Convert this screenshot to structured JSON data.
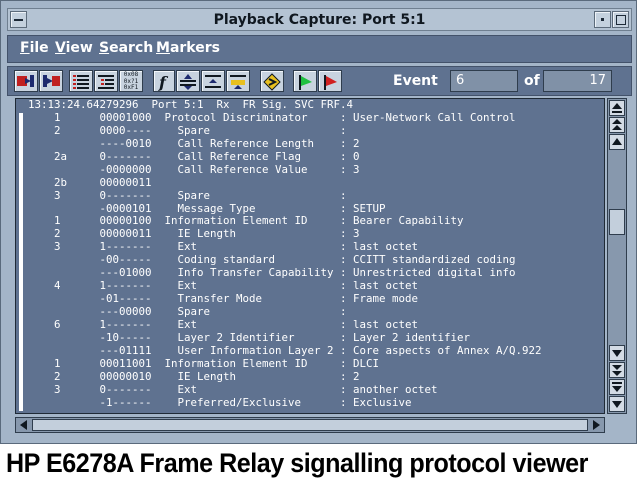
{
  "window": {
    "title": "Playback Capture: Port 5:1"
  },
  "menu": {
    "items": [
      "File",
      "View",
      "Search",
      "Markers"
    ]
  },
  "toolbar": {
    "buttons": [
      {
        "name": "import-icon"
      },
      {
        "name": "export-icon"
      },
      {
        "name": "summary-list-icon"
      },
      {
        "name": "detail-list-icon"
      },
      {
        "name": "hex-view-icon",
        "text": "0x08\n0x?1\n0xF1"
      },
      {
        "name": "filter-icon"
      },
      {
        "name": "expand-icon"
      },
      {
        "name": "collapse-icon"
      },
      {
        "name": "trigger-icon"
      },
      {
        "name": "scroll-icon"
      },
      {
        "name": "green-flag-icon"
      },
      {
        "name": "red-flag-icon"
      }
    ],
    "event_label": "Event",
    "event_value": "6",
    "of_label": "of",
    "total_value": "17"
  },
  "decode_lines": [
    "13:13:24.64279296  Port 5:1  Rx  FR Sig. SVC FRF.4",
    "    1      00001000  Protocol Discriminator     : User-Network Call Control",
    "    2      0000----    Spare                    :",
    "           ----0010    Call Reference Length    : 2",
    "    2a     0-------    Call Reference Flag      : 0",
    "           -0000000    Call Reference Value     : 3",
    "    2b     00000011",
    "    3      0-------    Spare                    :",
    "           -0000101    Message Type             : SETUP",
    "    1      00000100  Information Element ID     : Bearer Capability",
    "    2      00000011    IE Length                : 3",
    "    3      1-------    Ext                      : last octet",
    "           -00-----    Coding standard          : CCITT standardized coding",
    "           ---01000    Info Transfer Capability : Unrestricted digital info",
    "    4      1-------    Ext                      : last octet",
    "           -01-----    Transfer Mode            : Frame mode",
    "           ---00000    Spare                    :",
    "    6      1-------    Ext                      : last octet",
    "           -10-----    Layer 2 Identifier       : Layer 2 identifier",
    "           ---01111    User Information Layer 2 : Core aspects of Annex A/Q.922",
    "    1      00011001  Information Element ID     : DLCI",
    "    2      00000010    IE Length                : 2",
    "    3      0-------    Ext                      : another octet",
    "           -1------    Preferred/Exclusive      : Exclusive"
  ],
  "caption": "HP E6278A Frame Relay signalling protocol viewer",
  "colors": {
    "window_bg": "#a4b5c8",
    "panel_bg": "#5f7290",
    "text": "#ffffff"
  }
}
